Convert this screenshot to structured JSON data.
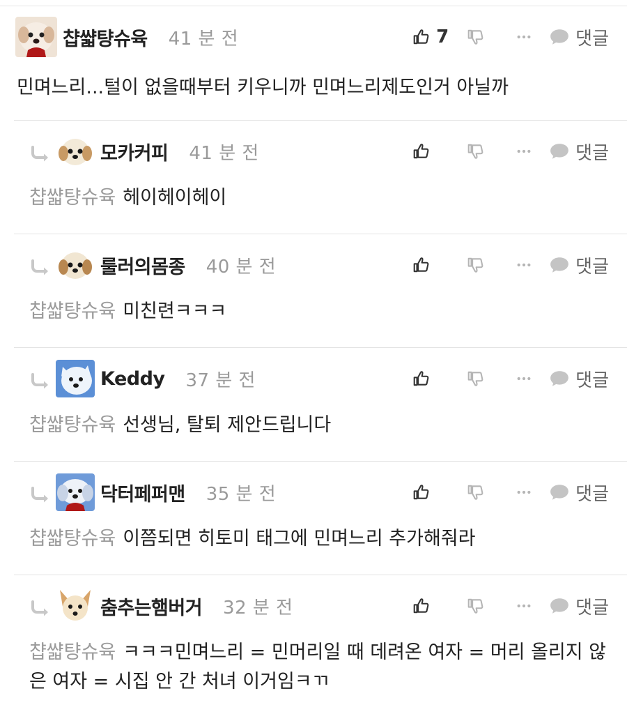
{
  "comments": [
    {
      "nickname": "챱쌻턍슈육",
      "time": "41 분 전",
      "like_count": "7",
      "reply_label": "댓글",
      "text": "민며느리...털이 없을때부터 키우니까 민며느리제도인거 아닐까"
    }
  ],
  "replies": [
    {
      "nickname": "모카커피",
      "time": "41 분 전",
      "reply_label": "댓글",
      "mention": "챱쌻턍슈육",
      "text": "헤이헤이헤이"
    },
    {
      "nickname": "룰러의몸종",
      "time": "40 분 전",
      "reply_label": "댓글",
      "mention": "챱쌻턍슈육",
      "text": "미친련ㅋㅋㅋ"
    },
    {
      "nickname": "Keddy",
      "time": "37 분 전",
      "reply_label": "댓글",
      "mention": "챱쌻턍슈육",
      "text": "선생님, 탈퇴 제안드립니다"
    },
    {
      "nickname": "닥터페퍼맨",
      "time": "35 분 전",
      "reply_label": "댓글",
      "mention": "챱쌻턍슈육",
      "text": "이쯤되면 히토미 태그에 민며느리 추가해줘라"
    },
    {
      "nickname": "춤추는햄버거",
      "time": "32 분 전",
      "reply_label": "댓글",
      "mention": "챱쌻턍슈육",
      "text": "ㅋㅋㅋ민며느리 = 민머리일 때 데려온 여자 = 머리 올리지 않은 여자 = 시집 안 간 처녀 이거임ㅋㄲ"
    }
  ],
  "icons": {
    "like": "thumbs-up-icon",
    "dislike": "thumbs-down-icon",
    "more": "more-dots-icon",
    "reply": "speech-bubble-icon",
    "reply_arrow": "reply-arrow-icon"
  },
  "colors": {
    "text": "#222222",
    "muted": "#9a9a9a",
    "divider": "#e3e3e3",
    "icon": "#b5b5b5",
    "icon_dark": "#333333"
  }
}
